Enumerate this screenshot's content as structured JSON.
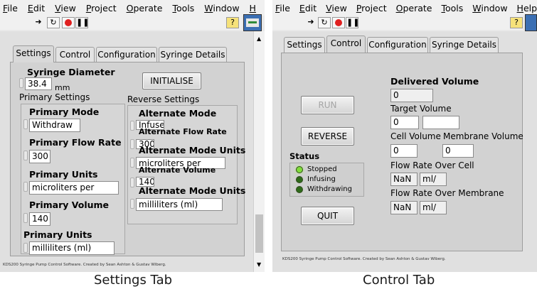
{
  "left": {
    "menu": [
      "File",
      "Edit",
      "View",
      "Project",
      "Operate",
      "Tools",
      "Window",
      "H"
    ],
    "tabs": [
      "Settings",
      "Control",
      "Configuration",
      "Syringe Details"
    ],
    "syringe_diameter_label": "Syringe Diameter",
    "syringe_diameter_value": "38.4",
    "syringe_diameter_unit": "mm",
    "initialise_label": "INITIALISE",
    "primary_settings_label": "Primary Settings",
    "reverse_settings_label": "Reverse Settings",
    "primary_mode_label": "Primary Mode",
    "primary_mode_value": "Withdraw",
    "primary_flow_rate_label": "Primary Flow Rate",
    "primary_flow_rate_value": "300",
    "primary_units_label": "Primary Units",
    "primary_units_value": "microliters per",
    "primary_volume_label": "Primary Volume",
    "primary_volume_value": "140",
    "primary_units2_label": "Primary Units",
    "primary_units2_value": "milliliters (ml)",
    "alt_mode_label": "Alternate Mode",
    "alt_mode_value": "Infuse",
    "alt_flow_rate_label": "Alternate Flow Rate",
    "alt_flow_rate_value": "300",
    "alt_mode_units_label": "Alternate Mode Units",
    "alt_mode_units_value": "microliters per",
    "alt_volume_label": "Alternate Volume",
    "alt_volume_value": "140",
    "alt_mode_units2_label": "Alternate Mode Units",
    "alt_mode_units2_value": "milliliters (ml)",
    "credit": "KDS200 Syringe Pump Control Software. Created by Sean Ashton & Gustav Wiberg.",
    "caption": "Settings Tab"
  },
  "right": {
    "menu": [
      "File",
      "Edit",
      "View",
      "Project",
      "Operate",
      "Tools",
      "Window",
      "Help"
    ],
    "tabs": [
      "Settings",
      "Control",
      "Configuration",
      "Syringe Details"
    ],
    "run_label": "RUN",
    "reverse_label": "REVERSE",
    "quit_label": "QUIT",
    "status_label": "Status",
    "status_items": [
      "Stopped",
      "Infusing",
      "Withdrawing"
    ],
    "delivered_volume_label": "Delivered Volume",
    "delivered_volume_value": "0",
    "target_volume_label": "Target Volume",
    "target_volume_value": "0",
    "cell_volume_label": "Cell Volume",
    "cell_volume_value": "0",
    "membrane_volume_label": "Membrane Volume",
    "membrane_volume_value": "0",
    "flow_rate_cell_label": "Flow Rate Over Cell",
    "flow_rate_cell_value": "NaN",
    "flow_rate_cell_unit": "ml/",
    "flow_rate_membrane_label": "Flow Rate Over Membrane",
    "flow_rate_membrane_value": "NaN",
    "flow_rate_membrane_unit": "ml/",
    "credit": "KDS200 Syringe Pump Control Software. Created by Sean Ashton & Gustav Wiberg.",
    "caption": "Control Tab"
  },
  "colors": {
    "led_on": "#7fdc3a",
    "led_off": "#2f6a1a",
    "run_button_grey": "#a5a5a5"
  }
}
